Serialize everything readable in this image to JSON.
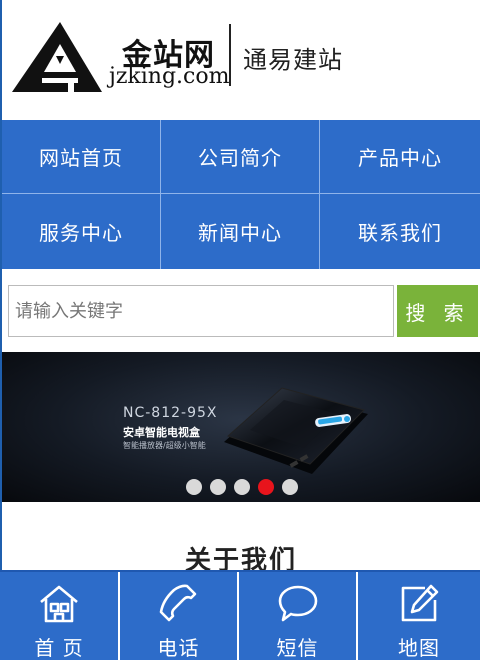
{
  "header": {
    "logo_text_cn": "金站网",
    "logo_text_en": "jzking.com",
    "slogan": "通易建站"
  },
  "nav": {
    "items": [
      {
        "label": "网站首页"
      },
      {
        "label": "公司简介"
      },
      {
        "label": "产品中心"
      },
      {
        "label": "服务中心"
      },
      {
        "label": "新闻中心"
      },
      {
        "label": "联系我们"
      }
    ]
  },
  "search": {
    "placeholder": "请输入关键字",
    "button_label": "搜 索"
  },
  "banner": {
    "model": "NC-812-95X",
    "title": "安卓智能电视盒",
    "subtitle": "智能播放器/超级小智能",
    "slide_count": 5,
    "active_slide": 4
  },
  "about": {
    "title": "关于我们"
  },
  "bottombar": {
    "tabs": [
      {
        "label": "首 页",
        "icon": "home-icon"
      },
      {
        "label": "电话",
        "icon": "phone-icon"
      },
      {
        "label": "短信",
        "icon": "message-icon"
      },
      {
        "label": "地图",
        "icon": "map-edit-icon"
      }
    ]
  },
  "colors": {
    "primary": "#2d6cc9",
    "search_button": "#7ab33a",
    "active_dot": "#e8141c"
  }
}
